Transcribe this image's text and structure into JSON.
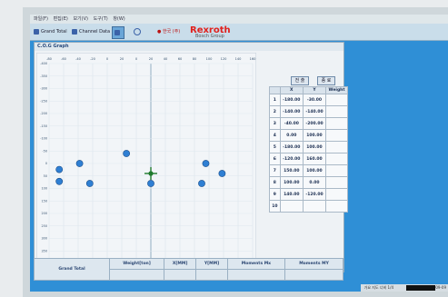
{
  "menubar": {
    "items": [
      "파일(F)",
      "편집(E)",
      "보기(V)",
      "도구(T)",
      "창(W)"
    ]
  },
  "toolbar": {
    "grand_total": "Grand Total",
    "channel_data": "Channel Data",
    "print": "",
    "settings": "",
    "brand_pre": "● 한국 (주)",
    "brand": "Rexroth",
    "brand_sub": "Bosch Group"
  },
  "panel": {
    "title": "C.O.G Graph",
    "btn_left": "전 출",
    "btn_right": "종 료"
  },
  "table": {
    "headers": [
      "",
      "X",
      "Y",
      "Weight"
    ],
    "rows": [
      {
        "no": "1",
        "x": "-180.00",
        "y": "-30.00",
        "w": ""
      },
      {
        "no": "2",
        "x": "-140.00",
        "y": "-140.00",
        "w": ""
      },
      {
        "no": "3",
        "x": "-40.00",
        "y": "-200.00",
        "w": ""
      },
      {
        "no": "4",
        "x": "0.00",
        "y": "100.00",
        "w": ""
      },
      {
        "no": "5",
        "x": "-180.00",
        "y": "100.00",
        "w": ""
      },
      {
        "no": "6",
        "x": "-120.00",
        "y": "160.00",
        "w": ""
      },
      {
        "no": "7",
        "x": "150.00",
        "y": "100.00",
        "w": ""
      },
      {
        "no": "8",
        "x": "100.00",
        "y": "0.00",
        "w": ""
      },
      {
        "no": "9",
        "x": "140.00",
        "y": "-120.00",
        "w": ""
      },
      {
        "no": "10",
        "x": "",
        "y": "",
        "w": ""
      }
    ]
  },
  "summary": {
    "row_label": "Grand Total",
    "headers": [
      "Weight[ton]",
      "X[MM]",
      "Y[MM]",
      "Moments Mx",
      "Moments MY"
    ]
  },
  "status": {
    "text": "가요 지도 너비 1/4",
    "date": "2009-09"
  },
  "colors": {
    "accent": "#2f8fd6",
    "marker": "#2f7fd3",
    "cog": "#1f7a2c",
    "brand": "#e0211d"
  },
  "chart_data": {
    "type": "scatter",
    "title": "",
    "xlabel": "",
    "ylabel": "",
    "x_ticks": [
      "-80",
      "-60",
      "-40",
      "-20",
      "0",
      "20",
      "0",
      "20",
      "40",
      "60",
      "80",
      "100",
      "120",
      "140",
      "160"
    ],
    "y_ticks": [
      "-400",
      "-350",
      "-300",
      "-250",
      "-200",
      "-150",
      "-100",
      "-50",
      "0",
      "50",
      "100",
      "150",
      "200",
      "250",
      "300",
      "350",
      "400"
    ],
    "points": [
      {
        "x": 0.05,
        "y": 0.53
      },
      {
        "x": 0.05,
        "y": 0.59
      },
      {
        "x": 0.15,
        "y": 0.5
      },
      {
        "x": 0.2,
        "y": 0.6
      },
      {
        "x": 0.38,
        "y": 0.45
      },
      {
        "x": 0.5,
        "y": 0.6
      },
      {
        "x": 0.77,
        "y": 0.5
      },
      {
        "x": 0.75,
        "y": 0.6
      },
      {
        "x": 0.85,
        "y": 0.55
      }
    ],
    "cog": {
      "x": 0.5,
      "y": 0.55
    },
    "grid": true
  }
}
